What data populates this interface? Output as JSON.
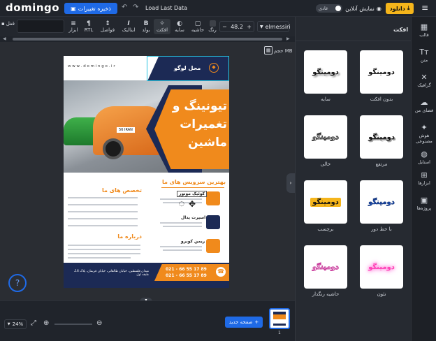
{
  "app": {
    "logo": "domingo",
    "save_button": "ذخیره تغییرات",
    "load_last": "Load Last Data",
    "theme_toggle_label": "عادی",
    "preview_button": "نمایش آنلاین",
    "download_button": "دانلود"
  },
  "toolbar": {
    "font_name": "elmessiri",
    "font_size": "48.2",
    "minus": "−",
    "plus": "+",
    "color_label": "رنگ",
    "border_label": "حاشیه",
    "shadow_label": "سایه",
    "effect_label": "افکت",
    "bold_label": "بولد",
    "italic_label": "ایتالیک",
    "spacing_label": "فواصل",
    "rtl_label": "RTL",
    "align_label": "ابزار",
    "lock_label": "قفل"
  },
  "canvas": {
    "size_label": "حجم MB"
  },
  "poster": {
    "website": "w w w . d o m i n g o . i r",
    "logo_place": "محل لوگو",
    "headline_1": "تیونینگ و",
    "headline_2": "تغمیرات",
    "headline_3": "ماشین",
    "plate": "56 IRAN",
    "services_title": "بهترین سرویس های ما",
    "specialty_title": "تخصص های ما",
    "about_title": "درباره ما",
    "service_1": "کوئیک موتور",
    "service_2": "اسپرت پدال",
    "service_3": "ریمن کوبرو",
    "phone_1": "021 - 66 55 17 89",
    "phone_2": "021 - 66 55 17 89",
    "address": "میدان فلسطین، خیابان طالقانی، خیابان قریمان، پلاک 16، طبقه اول"
  },
  "bottom": {
    "zoom": "24%",
    "new_page": "صفحه جدید",
    "page_number": "1"
  },
  "panel": {
    "title": "افکت",
    "effects": [
      {
        "label": "بدون افکت",
        "sample": "دومینگو"
      },
      {
        "label": "سایه",
        "sample": "دومینگو"
      },
      {
        "label": "مرتفع",
        "sample": "دومینگو"
      },
      {
        "label": "خالی",
        "sample": "دومینگو"
      },
      {
        "label": "با خط دور",
        "sample": "دومینگو"
      },
      {
        "label": "برچسب",
        "sample": "دومینگو"
      },
      {
        "label": "نئون",
        "sample": "دومینگو"
      },
      {
        "label": "حاشیه رنگدار",
        "sample": "دومینگو"
      }
    ]
  },
  "rail": {
    "items": [
      "قالب",
      "متن",
      "گرافیک",
      "فضای من",
      "هوش مصنوعی",
      "استایل",
      "ابزارها",
      "پروژه‌ها"
    ]
  },
  "colors": {
    "accent_blue": "#1f6ae6",
    "download_yellow": "#f5b51b",
    "poster_orange": "#f08a1c",
    "poster_navy": "#1c2a55"
  }
}
